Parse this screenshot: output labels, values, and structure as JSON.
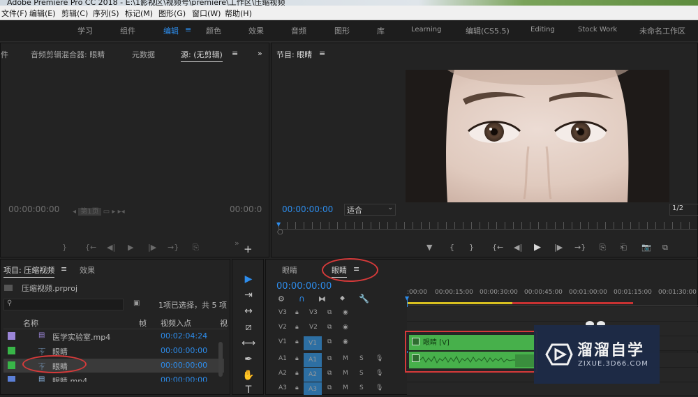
{
  "title_bar": {
    "text": "Adobe Premiere Pro CC 2018 - E:\\1影视区\\视频号\\premiere\\工作区\\压缩视频"
  },
  "menu": [
    "文件(F)",
    "编辑(E)",
    "剪辑(C)",
    "序列(S)",
    "标记(M)",
    "图形(G)",
    "窗口(W)",
    "帮助(H)"
  ],
  "workspaces": [
    "学习",
    "组件",
    "编辑",
    "颜色",
    "效果",
    "音频",
    "图形",
    "库",
    "Learning",
    "编辑(CS5.5)",
    "Editing",
    "Stock Work",
    "未命名工作区"
  ],
  "workspace_menu_icon": "≡",
  "source_panel": {
    "tabs": [
      "件",
      "音频剪辑混合器: 眼睛",
      "元数据",
      "源: (无剪辑)"
    ],
    "more": "»",
    "timecode_left": "00:00:00:00",
    "page": "第1页",
    "timecode_right": "00:00:0",
    "controls": [
      "}",
      "{←",
      "◀|",
      "▶",
      "|▶",
      "→}",
      "⎘"
    ],
    "add": "+"
  },
  "program_panel": {
    "title": "节目: 眼睛",
    "timecode": "00:00:00:00",
    "fit": "适合",
    "ratio": "1/2",
    "controls": [
      "▼",
      "{",
      "}",
      "{←",
      "◀|",
      "▶",
      "|▶",
      "→}",
      "⎘",
      "⎗",
      "📷",
      "⧉"
    ]
  },
  "project_panel": {
    "tab": "项目: 压缩视频",
    "tab_menu": "≡",
    "effects_tab": "效果",
    "file": "压缩视频.prproj",
    "selection_info": "1项已选择，共 5 项",
    "headers": [
      "名称",
      "帧",
      "视频入点",
      "视"
    ],
    "rows": [
      {
        "name": "医学实验室.mp4",
        "time": "00:02:04:24",
        "color": "#9b86d8"
      },
      {
        "name": "眼睛",
        "time": "00:00:00:00",
        "color": "#38b548"
      },
      {
        "name": "眼睛",
        "time": "00:00:00:00",
        "color": "#38b548"
      },
      {
        "name": "眼睛.mp4",
        "time": "00:00:00:00",
        "color": "#5b7fd6"
      }
    ]
  },
  "tools": [
    "▶",
    "⇥",
    "↔",
    "⧄",
    "⟷",
    "✒",
    "✋",
    "T"
  ],
  "timeline": {
    "tabs": [
      "眼睛",
      "眼睛"
    ],
    "tab_menu": "≡",
    "timecode": "00:00:00:00",
    "ruler": [
      ":00:00",
      "00:00:15:00",
      "00:00:30:00",
      "00:00:45:00",
      "00:01:00:00",
      "00:01:15:00",
      "00:01:30:00"
    ],
    "tracks": [
      {
        "label": "V3",
        "target": "V3"
      },
      {
        "label": "V2",
        "target": "V2"
      },
      {
        "label": "V1",
        "target": "V1"
      },
      {
        "label": "A1",
        "target": "A1"
      },
      {
        "label": "A2",
        "target": "A2"
      },
      {
        "label": "A3",
        "target": "A3"
      }
    ],
    "clip_video": "眼睛 [V]",
    "mute": "M",
    "solo": "S"
  },
  "watermark": {
    "title": "溜溜自学",
    "url": "ZIXUE.3D66.COM"
  }
}
